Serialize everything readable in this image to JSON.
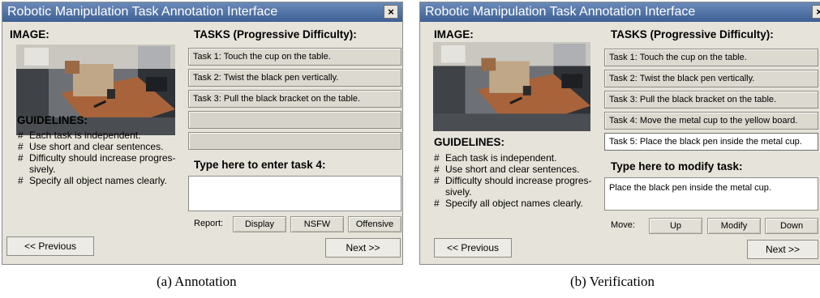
{
  "panels": [
    {
      "title": "Robotic Manipulation Task Annotation Interface",
      "close_glyph": "×",
      "image_heading": "IMAGE:",
      "tasks_heading": "TASKS (Progressive Difficulty):",
      "tasks": [
        {
          "text": "Task 1: Touch the cup on the table.",
          "state": "filled"
        },
        {
          "text": "Task 2: Twist the black pen vertically.",
          "state": "filled"
        },
        {
          "text": "Task 3: Pull the black bracket on the table.",
          "state": "filled"
        },
        {
          "text": "",
          "state": "empty"
        },
        {
          "text": "",
          "state": "empty"
        }
      ],
      "guidelines_heading": "GUIDELINES:",
      "guidelines": [
        "Each task is independent.",
        "Use short and clear sentences.",
        "Difficulty should increase progres-\nsively.",
        "Specify all object names clearly."
      ],
      "input_heading": "Type here to enter task 4:",
      "input_value": "",
      "row_label": "Report:",
      "row_buttons": [
        "Display",
        "NSFW",
        "Offensive"
      ],
      "prev_label": "<< Previous",
      "next_label": "Next >>",
      "caption": "(a)  Annotation"
    },
    {
      "title": "Robotic Manipulation Task Annotation Interface",
      "close_glyph": "×",
      "image_heading": "IMAGE:",
      "tasks_heading": "TASKS (Progressive Difficulty):",
      "tasks": [
        {
          "text": "Task 1: Touch the cup on the table.",
          "state": "filled"
        },
        {
          "text": "Task 2: Twist the black pen vertically.",
          "state": "filled"
        },
        {
          "text": "Task 3: Pull the black bracket on the table.",
          "state": "filled"
        },
        {
          "text": "Task 4: Move the metal cup to the yellow board.",
          "state": "filled"
        },
        {
          "text": "Task 5: Place the black pen inside the metal cup.",
          "state": "selected"
        }
      ],
      "guidelines_heading": "GUIDELINES:",
      "guidelines": [
        "Each task is independent.",
        "Use short and clear sentences.",
        "Difficulty should increase progres-\nsively.",
        "Specify all object names clearly."
      ],
      "input_heading": "Type here to modify task:",
      "input_value": "Place the black pen inside the metal cup.",
      "row_label": "Move:",
      "row_buttons": [
        "Up",
        "Modify",
        "Down"
      ],
      "prev_label": "<< Previous",
      "next_label": "Next >>",
      "caption": "(b)  Verification"
    }
  ]
}
